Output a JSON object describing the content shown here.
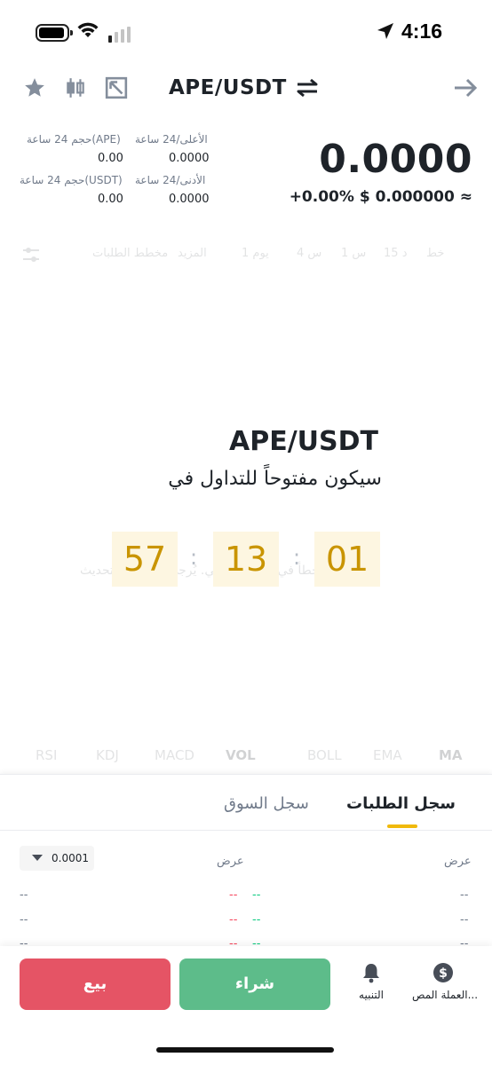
{
  "status_bar": {
    "time": "4:16"
  },
  "header": {
    "pair": "APE/USDT"
  },
  "stats": {
    "high_label": "الأعلى/24 ساعة",
    "high_value": "0.0000",
    "vol_base_label": "حجم 24 ساعة(APE)",
    "vol_base_value": "0.00",
    "low_label": "الأدنى/24 ساعة",
    "low_value": "0.0000",
    "vol_quote_label": "حجم 24 ساعة(USDT)",
    "vol_quote_value": "0.00",
    "last_price": "0.0000",
    "change_and_fiat": "+0.00%  $ 0.000000 ≈"
  },
  "chart_toolbar": {
    "items": [
      "خط",
      "15 د",
      "1 س",
      "4 س",
      "1 يوم",
      "المزيد",
      "مخطط الطلبات"
    ]
  },
  "chart_error": "حدث خطأ في الرسم البياني. يُرجى السحب للتحديث.",
  "countdown": {
    "title": "APE/USDT",
    "subtitle": "سيكون مفتوحاً للتداول في",
    "boxes": [
      "57",
      "13",
      "01"
    ],
    "separator": ":",
    "accent_color": "#c99400"
  },
  "indicators": [
    "RSI",
    "KDJ",
    "MACD",
    "VOL",
    "BOLL",
    "EMA",
    "MA"
  ],
  "order_book": {
    "tabs": {
      "active": "سجل الطلبات",
      "inactive": "سجل السوق"
    },
    "precision": "0.0001",
    "col_left": "عرض",
    "col_right": "عرض",
    "placeholder": "--"
  },
  "action_bar": {
    "sell": "بيع",
    "buy": "شراء",
    "alert": "التنبيه",
    "fiat": "العملة المص..."
  },
  "colors": {
    "sell": "#e55465",
    "buy": "#5dbc8a",
    "accent": "#f0b90b",
    "red": "#f6465d",
    "green": "#0ecb81"
  }
}
